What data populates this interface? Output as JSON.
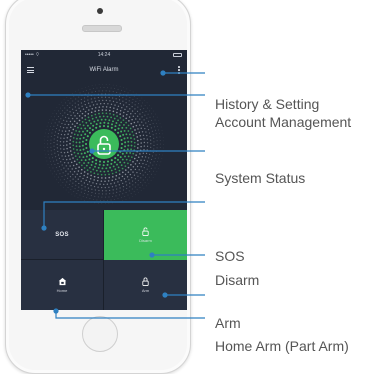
{
  "status_bar": {
    "carrier": "••••• ⌔",
    "time": "14:24"
  },
  "app": {
    "title": "WiFi Alarm"
  },
  "center_icon": "unlocked-padlock-icon",
  "tiles": {
    "sos": {
      "label": "SOS"
    },
    "disarm": {
      "label": "Disarm",
      "icon": "unlocked-padlock-icon"
    },
    "home": {
      "label": "Home",
      "icon": "house-lock-icon"
    },
    "arm": {
      "label": "Arm",
      "icon": "padlock-icon"
    }
  },
  "colors": {
    "screen": "#212836",
    "tile": "#283041",
    "active_green": "#3bbb5b",
    "callout_line": "#2f80c1"
  },
  "callouts": {
    "history_setting": "History & Setting",
    "account_management": "Account Management",
    "system_status": "System Status",
    "sos": "SOS",
    "disarm": "Disarm",
    "arm": "Arm",
    "home_arm": "Home Arm (Part Arm)"
  }
}
